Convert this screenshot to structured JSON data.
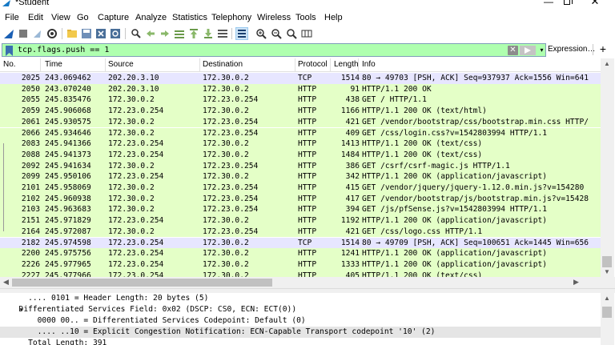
{
  "window": {
    "title": "*Student",
    "min": "—",
    "close": "✕"
  },
  "menu": [
    "File",
    "Edit",
    "View",
    "Go",
    "Capture",
    "Analyze",
    "Statistics",
    "Telephony",
    "Wireless",
    "Tools",
    "Help"
  ],
  "filter": {
    "value": "tcp.flags.push == 1",
    "expression_label": "Expression…",
    "plus": "+",
    "clear": "✕",
    "dropdown": "▾"
  },
  "columns": [
    "No.",
    "Time",
    "Source",
    "Destination",
    "Protocol",
    "Length",
    "Info"
  ],
  "packets": [
    {
      "no": "2025",
      "time": "243.069462",
      "src": "202.20.3.10",
      "dst": "172.30.0.2",
      "proto": "TCP",
      "len": "1514",
      "info": "80 → 49703 [PSH, ACK] Seq=937937 Ack=1556 Win=641"
    },
    {
      "no": "2050",
      "time": "243.070240",
      "src": "202.20.3.10",
      "dst": "172.30.0.2",
      "proto": "HTTP",
      "len": "91",
      "info": "HTTP/1.1 200 OK"
    },
    {
      "no": "2055",
      "time": "245.835476",
      "src": "172.30.0.2",
      "dst": "172.23.0.254",
      "proto": "HTTP",
      "len": "438",
      "info": "GET / HTTP/1.1"
    },
    {
      "no": "2059",
      "time": "245.906068",
      "src": "172.23.0.254",
      "dst": "172.30.0.2",
      "proto": "HTTP",
      "len": "1166",
      "info": "HTTP/1.1 200 OK  (text/html)"
    },
    {
      "no": "2061",
      "time": "245.930575",
      "src": "172.30.0.2",
      "dst": "172.23.0.254",
      "proto": "HTTP",
      "len": "421",
      "info": "GET /vendor/bootstrap/css/bootstrap.min.css HTTP/"
    },
    {
      "no": "2066",
      "time": "245.934646",
      "src": "172.30.0.2",
      "dst": "172.23.0.254",
      "proto": "HTTP",
      "len": "409",
      "info": "GET /css/login.css?v=1542803994 HTTP/1.1"
    },
    {
      "no": "2083",
      "time": "245.941366",
      "src": "172.23.0.254",
      "dst": "172.30.0.2",
      "proto": "HTTP",
      "len": "1413",
      "info": "HTTP/1.1 200 OK  (text/css)"
    },
    {
      "no": "2088",
      "time": "245.941373",
      "src": "172.23.0.254",
      "dst": "172.30.0.2",
      "proto": "HTTP",
      "len": "1484",
      "info": "HTTP/1.1 200 OK  (text/css)"
    },
    {
      "no": "2092",
      "time": "245.941634",
      "src": "172.30.0.2",
      "dst": "172.23.0.254",
      "proto": "HTTP",
      "len": "386",
      "info": "GET /csrf/csrf-magic.js HTTP/1.1"
    },
    {
      "no": "2099",
      "time": "245.950106",
      "src": "172.23.0.254",
      "dst": "172.30.0.2",
      "proto": "HTTP",
      "len": "342",
      "info": "HTTP/1.1 200 OK  (application/javascript)"
    },
    {
      "no": "2101",
      "time": "245.958069",
      "src": "172.30.0.2",
      "dst": "172.23.0.254",
      "proto": "HTTP",
      "len": "415",
      "info": "GET /vendor/jquery/jquery-1.12.0.min.js?v=154280"
    },
    {
      "no": "2102",
      "time": "245.960938",
      "src": "172.30.0.2",
      "dst": "172.23.0.254",
      "proto": "HTTP",
      "len": "417",
      "info": "GET /vendor/bootstrap/js/bootstrap.min.js?v=15428"
    },
    {
      "no": "2103",
      "time": "245.963683",
      "src": "172.30.0.2",
      "dst": "172.23.0.254",
      "proto": "HTTP",
      "len": "394",
      "info": "GET /js/pfSense.js?v=1542803994 HTTP/1.1"
    },
    {
      "no": "2151",
      "time": "245.971829",
      "src": "172.23.0.254",
      "dst": "172.30.0.2",
      "proto": "HTTP",
      "len": "1192",
      "info": "HTTP/1.1 200 OK  (application/javascript)"
    },
    {
      "no": "2164",
      "time": "245.972087",
      "src": "172.30.0.2",
      "dst": "172.23.0.254",
      "proto": "HTTP",
      "len": "421",
      "info": "GET /css/logo.css HTTP/1.1"
    },
    {
      "no": "2182",
      "time": "245.974598",
      "src": "172.23.0.254",
      "dst": "172.30.0.2",
      "proto": "TCP",
      "len": "1514",
      "info": "80 → 49709 [PSH, ACK] Seq=100651 Ack=1445 Win=656"
    },
    {
      "no": "2200",
      "time": "245.975756",
      "src": "172.23.0.254",
      "dst": "172.30.0.2",
      "proto": "HTTP",
      "len": "1241",
      "info": "HTTP/1.1 200 OK  (application/javascript)"
    },
    {
      "no": "2226",
      "time": "245.977965",
      "src": "172.23.0.254",
      "dst": "172.30.0.2",
      "proto": "HTTP",
      "len": "1333",
      "info": "HTTP/1.1 200 OK  (application/javascript)"
    },
    {
      "no": "2227",
      "time": "245.977966",
      "src": "172.23.0.254",
      "dst": "172.30.0.2",
      "proto": "HTTP",
      "len": "405",
      "info": "HTTP/1.1 200 OK  (text/css)"
    }
  ],
  "details": [
    {
      "text": "    .... 0101 = Header Length: 20 bytes (5)",
      "expander": ""
    },
    {
      "text": "  Differentiated Services Field: 0x02 (DSCP: CS0, ECN: ECT(0))",
      "expander": "▾"
    },
    {
      "text": "      0000 00.. = Differentiated Services Codepoint: Default (0)",
      "expander": ""
    },
    {
      "text": "      .... ..10 = Explicit Congestion Notification: ECN-Capable Transport codepoint '10' (2)",
      "expander": ""
    },
    {
      "text": "    Total Length: 391",
      "expander": ""
    }
  ],
  "colors": {
    "http_row": "#e4ffc7",
    "tcp_row": "#e7e6ff",
    "filter_ok": "#afffaf",
    "selected_detail": "#e5e5e5"
  }
}
